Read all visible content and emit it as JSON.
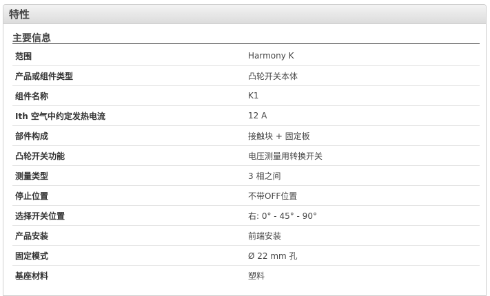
{
  "panel": {
    "title": "特性"
  },
  "section": {
    "title": "主要信息"
  },
  "rows": [
    {
      "label": "范围",
      "value": "Harmony K"
    },
    {
      "label": "产品或组件类型",
      "value": "凸轮开关本体"
    },
    {
      "label": "组件名称",
      "value": "K1"
    },
    {
      "label": "Ith 空气中约定发热电流",
      "value": "12 A"
    },
    {
      "label": "部件构成",
      "value": "接触块 + 固定板"
    },
    {
      "label": "凸轮开关功能",
      "value": "电压测量用转换开关"
    },
    {
      "label": "测量类型",
      "value": "3 相之间"
    },
    {
      "label": "停止位置",
      "value": "不带OFF位置"
    },
    {
      "label": "选择开关位置",
      "value": "右: 0° - 45° - 90°"
    },
    {
      "label": "产品安装",
      "value": "前端安装"
    },
    {
      "label": "固定模式",
      "value": "Ø 22 mm 孔"
    },
    {
      "label": "基座材料",
      "value": "塑料"
    }
  ]
}
